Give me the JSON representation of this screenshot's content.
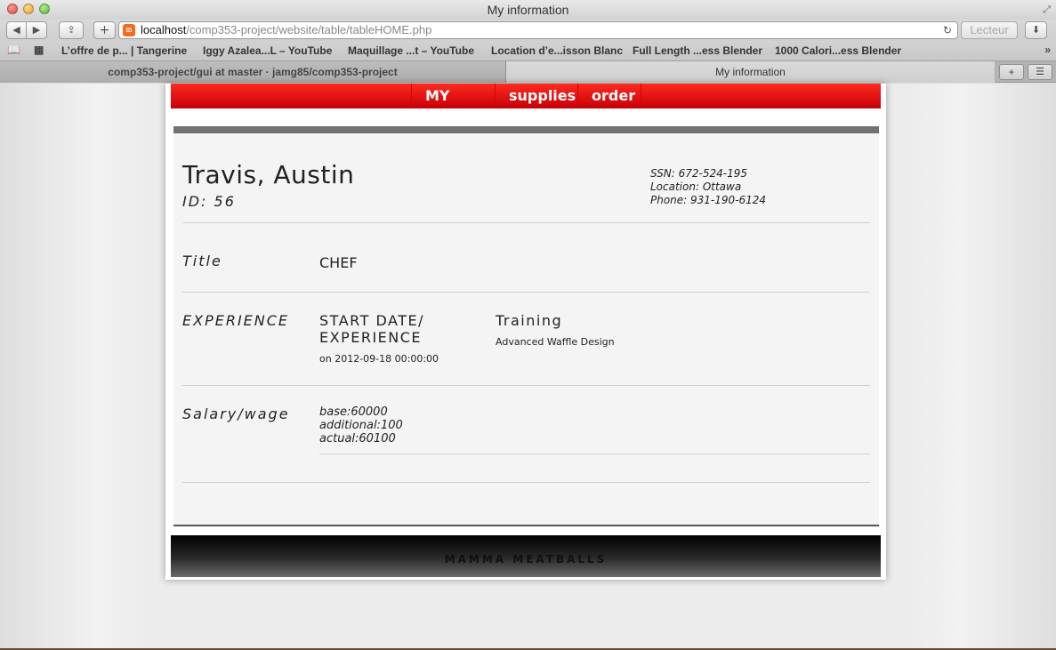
{
  "window": {
    "title": "My information"
  },
  "toolbar": {
    "url_host": "localhost",
    "url_path": "/comp353-project/website/table/tableHOME.php",
    "reader_label": "Lecteur"
  },
  "bookmarks": [
    "L’offre de p... | Tangerine",
    "Iggy Azalea...L – YouTube",
    "Maquillage ...t – YouTube",
    "Location d’e...isson Blanc",
    "Full Length ...ess Blender",
    "1000 Calori...ess Blender"
  ],
  "tabs": [
    {
      "label": "comp353-project/gui at master · jamg85/comp353-project"
    },
    {
      "label": "My information"
    }
  ],
  "nav": {
    "myinfo": "MY INFO",
    "supplies": "supplies",
    "order": "order"
  },
  "employee": {
    "name": "Travis, Austin",
    "id": "ID: 56",
    "ssn": "SSN: 672-524-195",
    "location": "Location: Ottawa",
    "phone": "Phone: 931-190-6124"
  },
  "title_section": {
    "label": "Title",
    "value": "CHEF"
  },
  "experience": {
    "label": "EXPERIENCE",
    "start_header_line1": "START DATE/",
    "start_header_line2": "EXPERIENCE",
    "start_value": "on 2012-09-18 00:00:00",
    "training_header": "Training",
    "training_value": "Advanced Waffle Design"
  },
  "salary": {
    "label": "Salary/wage",
    "base": "base:60000",
    "additional": "additional:100",
    "actual": "actual:60100"
  },
  "footer": {
    "text": "MAMMA MEATBALLS"
  }
}
